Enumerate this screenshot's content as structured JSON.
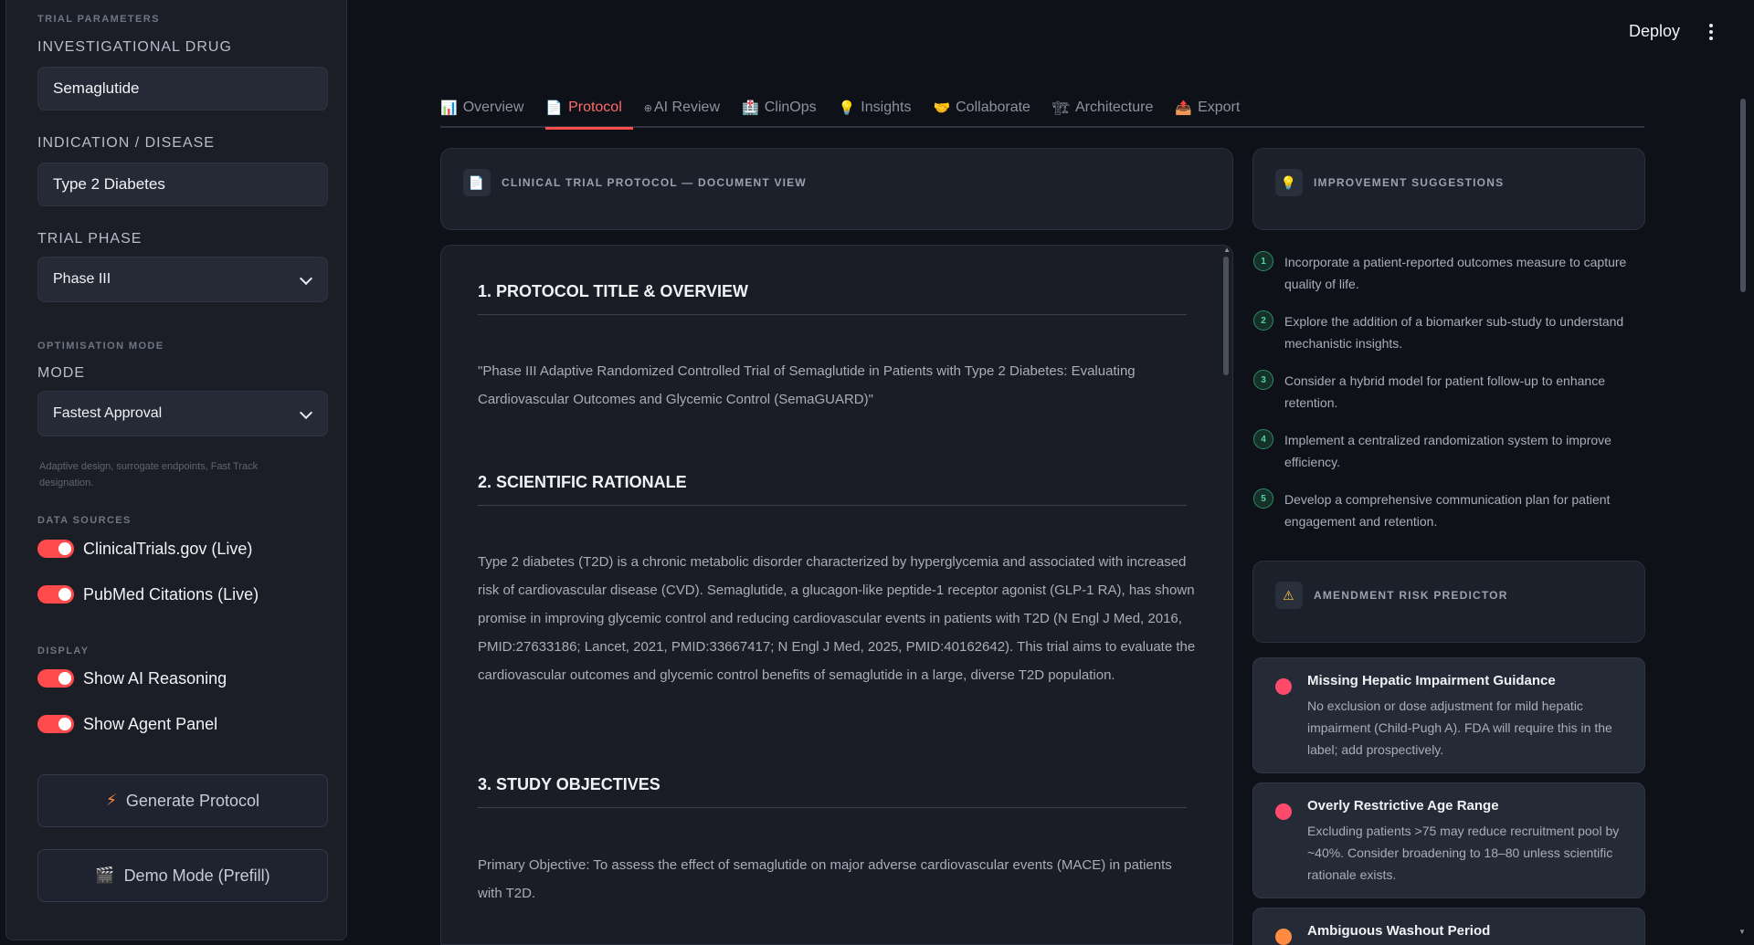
{
  "sidebar": {
    "trial_parameters": "TRIAL PARAMETERS",
    "drug_label": "INVESTIGATIONAL DRUG",
    "drug_value": "Semaglutide",
    "indication_label": "INDICATION / DISEASE",
    "indication_value": "Type 2 Diabetes",
    "phase_label": "TRIAL PHASE",
    "phase_value": "Phase III",
    "optimisation_section": "OPTIMISATION MODE",
    "mode_label": "MODE",
    "mode_value": "Fastest Approval",
    "mode_hint": "Adaptive design, surrogate endpoints, Fast Track designation.",
    "data_sources_section": "DATA SOURCES",
    "source_1": "ClinicalTrials.gov (Live)",
    "source_2": "PubMed Citations (Live)",
    "display_section": "DISPLAY",
    "display_1": "Show AI Reasoning",
    "display_2": "Show Agent Panel",
    "generate_button": "Generate Protocol",
    "demo_button": "Demo Mode (Prefill)"
  },
  "header": {
    "deploy": "Deploy"
  },
  "tabs": [
    {
      "icon": "📊",
      "label": "Overview"
    },
    {
      "icon": "📄",
      "label": "Protocol"
    },
    {
      "icon": "⊕",
      "label": "AI Review"
    },
    {
      "icon": "🏥",
      "label": "ClinOps"
    },
    {
      "icon": "💡",
      "label": "Insights"
    },
    {
      "icon": "🤝",
      "label": "Collaborate"
    },
    {
      "icon": "🏗",
      "label": "Architecture"
    },
    {
      "icon": "📤",
      "label": "Export"
    }
  ],
  "active_tab": "Protocol",
  "doc_header": {
    "icon": "📄",
    "title": "CLINICAL TRIAL PROTOCOL — DOCUMENT VIEW"
  },
  "suggestions_header": {
    "icon": "💡",
    "title": "IMPROVEMENT SUGGESTIONS"
  },
  "risk_header": {
    "icon": "⚠",
    "title": "AMENDMENT RISK PREDICTOR"
  },
  "document": {
    "s1_title": "1. PROTOCOL TITLE & OVERVIEW",
    "s1_body": "\"Phase III Adaptive Randomized Controlled Trial of Semaglutide in Patients with Type 2 Diabetes: Evaluating Cardiovascular Outcomes and Glycemic Control (SemaGUARD)\"",
    "s2_title": "2. SCIENTIFIC RATIONALE",
    "s2_body": "Type 2 diabetes (T2D) is a chronic metabolic disorder characterized by hyperglycemia and associated with increased risk of cardiovascular disease (CVD). Semaglutide, a glucagon-like peptide-1 receptor agonist (GLP-1 RA), has shown promise in improving glycemic control and reducing cardiovascular events in patients with T2D (N Engl J Med, 2016, PMID:27633186; Lancet, 2021, PMID:33667417; N Engl J Med, 2025, PMID:40162642). This trial aims to evaluate the cardiovascular outcomes and glycemic control benefits of semaglutide in a large, diverse T2D population.",
    "s3_title": "3. STUDY OBJECTIVES",
    "s3_body": "Primary Objective: To assess the effect of semaglutide on major adverse cardiovascular events (MACE) in patients with T2D."
  },
  "suggestions": [
    {
      "num": "1",
      "text": "Incorporate a patient-reported outcomes measure to capture quality of life."
    },
    {
      "num": "2",
      "text": "Explore the addition of a biomarker sub-study to understand mechanistic insights."
    },
    {
      "num": "3",
      "text": "Consider a hybrid model for patient follow-up to enhance retention."
    },
    {
      "num": "4",
      "text": "Implement a centralized randomization system to improve efficiency."
    },
    {
      "num": "5",
      "text": "Develop a comprehensive communication plan for patient engagement and retention."
    }
  ],
  "risks": [
    {
      "title": "Missing Hepatic Impairment Guidance",
      "desc": "No exclusion or dose adjustment for mild hepatic impairment (Child-Pugh A). FDA will require this in the label; add prospectively.",
      "severity_color": "#ff4b6b"
    },
    {
      "title": "Overly Restrictive Age Range",
      "desc": "Excluding patients >75 may reduce recruitment pool by ~40%. Consider broadening to 18–80 unless scientific rationale exists.",
      "severity_color": "#ff4b6b"
    },
    {
      "title": "Ambiguous Washout Period",
      "desc": "",
      "severity_color": "#ff8c42"
    }
  ]
}
